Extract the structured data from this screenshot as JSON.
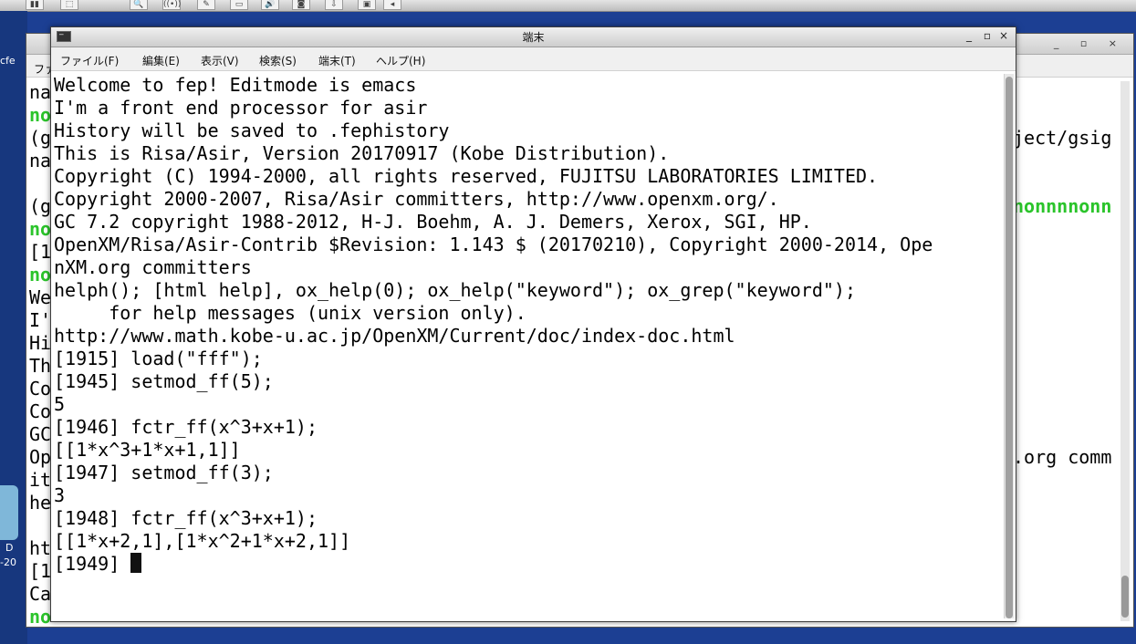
{
  "topbar": {
    "buttons": [
      "▮▮",
      "⬚",
      "🔍",
      "((•))",
      "✎",
      "▭",
      "🔊",
      "◙",
      "⇩",
      "▣",
      "◂"
    ]
  },
  "desktop": {
    "icon_text": [
      "D",
      "-20"
    ],
    "edge_text": [
      "cfe"
    ]
  },
  "background_window": {
    "menu_fragment": "ファ",
    "controls": "_ ▫ ×",
    "left_lines": [
      {
        "t": "na",
        "g": false
      },
      {
        "t": "no",
        "g": true
      },
      {
        "t": "(g",
        "g": false
      },
      {
        "t": "na",
        "g": false
      },
      {
        "t": "",
        "g": false
      },
      {
        "t": "(g",
        "g": false
      },
      {
        "t": "no",
        "g": true
      },
      {
        "t": "[1",
        "g": false
      },
      {
        "t": "no",
        "g": true
      },
      {
        "t": "We",
        "g": false
      },
      {
        "t": "I'",
        "g": false
      },
      {
        "t": "Hi",
        "g": false
      },
      {
        "t": "Th",
        "g": false
      },
      {
        "t": "Co",
        "g": false
      },
      {
        "t": "Co",
        "g": false
      },
      {
        "t": "GC",
        "g": false
      },
      {
        "t": "Op",
        "g": false
      },
      {
        "t": "it",
        "g": false
      },
      {
        "t": "he",
        "g": false
      },
      {
        "t": "",
        "g": false
      },
      {
        "t": "ht",
        "g": false
      },
      {
        "t": "[1",
        "g": false
      },
      {
        "t": "Ca",
        "g": false
      }
    ],
    "right_fragments": [
      {
        "t": "ject/gsig",
        "g": false,
        "row": 2
      },
      {
        "t": "nonnnnonn",
        "g": true,
        "row": 5
      },
      {
        "t": ".org comm",
        "g": false,
        "row": 16
      }
    ],
    "bottom_line": "no"
  },
  "window": {
    "title": "端末",
    "controls": {
      "minimize": "_",
      "maximize": "▫",
      "close": "×"
    },
    "menu": [
      "ファイル(F)",
      "編集(E)",
      "表示(V)",
      "検索(S)",
      "端末(T)",
      "ヘルプ(H)"
    ],
    "terminal_lines": [
      "Welcome to fep! Editmode is emacs",
      "I'm a front end processor for asir",
      "History will be saved to .fephistory",
      "This is Risa/Asir, Version 20170917 (Kobe Distribution).",
      "Copyright (C) 1994-2000, all rights reserved, FUJITSU LABORATORIES LIMITED.",
      "Copyright 2000-2007, Risa/Asir committers, http://www.openxm.org/.",
      "GC 7.2 copyright 1988-2012, H-J. Boehm, A. J. Demers, Xerox, SGI, HP.",
      "OpenXM/Risa/Asir-Contrib $Revision: 1.143 $ (20170210), Copyright 2000-2014, Ope",
      "nXM.org committers",
      "helph(); [html help], ox_help(0); ox_help(\"keyword\"); ox_grep(\"keyword\");",
      "     for help messages (unix version only).",
      "http://www.math.kobe-u.ac.jp/OpenXM/Current/doc/index-doc.html",
      "[1915] load(\"fff\");",
      "[1945] setmod_ff(5);",
      "5",
      "[1946] fctr_ff(x^3+x+1);",
      "[[1*x^3+1*x+1,1]]",
      "[1947] setmod_ff(3);",
      "3",
      "[1948] fctr_ff(x^3+x+1);",
      "[[1*x+2,1],[1*x^2+1*x+2,1]]"
    ],
    "prompt": "[1949]"
  }
}
